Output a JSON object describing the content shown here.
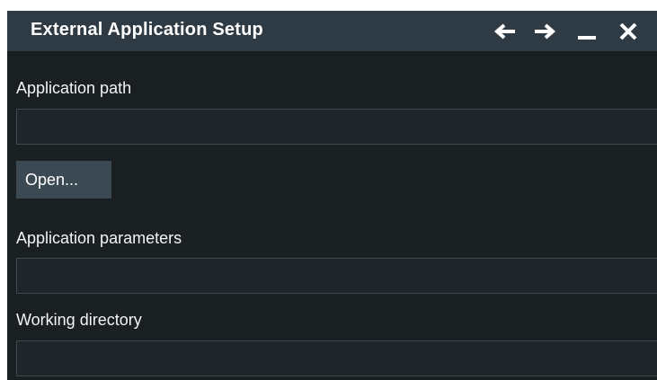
{
  "dialog": {
    "title": "External Application Setup",
    "controls": {
      "back_icon": "arrow-left-icon",
      "forward_icon": "arrow-right-icon",
      "minimize_icon": "minimize-icon",
      "close_icon": "close-icon"
    }
  },
  "fields": {
    "application_path": {
      "label": "Application path",
      "value": "",
      "placeholder": ""
    },
    "open_button": {
      "label": "Open..."
    },
    "application_parameters": {
      "label": "Application parameters",
      "value": "",
      "placeholder": ""
    },
    "working_directory": {
      "label": "Working directory",
      "value": "",
      "placeholder": ""
    }
  },
  "colors": {
    "titlebar_bg": "#2f3b44",
    "dialog_bg": "#1a1f22",
    "input_bg": "#1f262a",
    "input_border": "#3f4b52",
    "button_bg": "#3b4a52",
    "text": "#ffffff"
  }
}
